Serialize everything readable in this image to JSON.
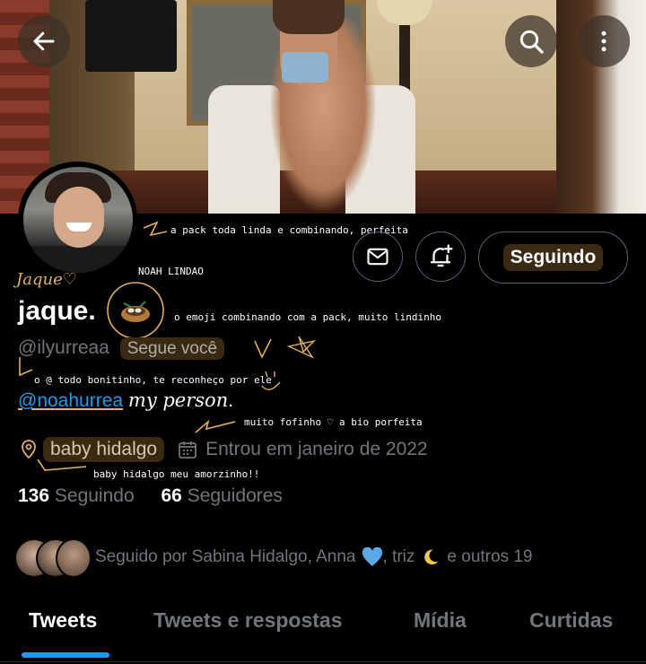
{
  "nav": {
    "back_icon": "arrow-left-icon",
    "search_icon": "search-icon",
    "more_icon": "more-vertical-icon"
  },
  "profile": {
    "display_name": "jaque.",
    "handle": "@ilyurreaa",
    "follows_you": "Segue você",
    "bio_mention": "@noahurrea",
    "bio_text": "my person",
    "bio_end": ".",
    "location": "baby hidalgo",
    "joined": "Entrou em janeiro de 2022",
    "following_count": "136",
    "following_label": "Seguindo",
    "followers_count": "66",
    "followers_label": "Seguidores",
    "followed_by_prefix": "Seguido por Sabina Hidalgo, Anna",
    "followed_by_mid": ", triz",
    "followed_by_suffix": "e outros 19"
  },
  "actions": {
    "message_icon": "mail-icon",
    "notify_icon": "bell-plus-icon",
    "follow_button": "Seguindo"
  },
  "annotations": {
    "pack": "a pack toda linda e combinando, perfeita",
    "avatar_note": "NOAH LINDAO",
    "signature": "Jaque♡",
    "emoji_note": "o emoji combinando com a pack, muito lindinho",
    "handle_note": "o @ todo bonitinho, te reconheço por ele",
    "bio_note": "muito fofinho ♡ a bio porfeita",
    "location_note": "baby hidalgo meu amorzinho!!"
  },
  "tabs": [
    {
      "label": "Tweets",
      "active": true
    },
    {
      "label": "Tweets e respostas",
      "active": false
    },
    {
      "label": "Mídia",
      "active": false
    },
    {
      "label": "Curtidas",
      "active": false
    }
  ],
  "colors": {
    "accent": "#1d9bf0",
    "secondary_text": "#71767b",
    "highlight": "#e0b060"
  }
}
